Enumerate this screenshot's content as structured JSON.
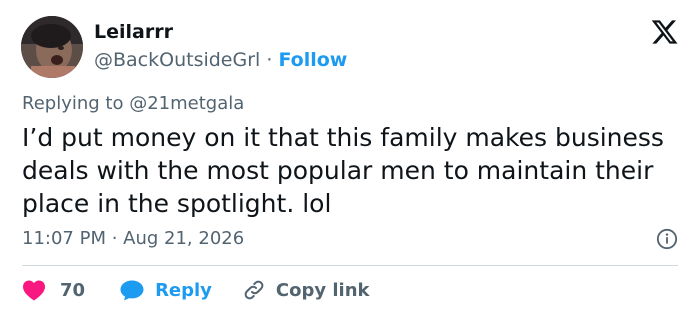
{
  "author": {
    "display_name": "Leilarrr",
    "handle": "@BackOutsideGrl",
    "separator": "·",
    "follow_label": "Follow"
  },
  "reply_context": {
    "prefix": "Replying to",
    "target_handle": "@21metgala"
  },
  "tweet": {
    "text": "I’d put money on it that this family makes business deals with the most popular men to maintain their place in the spotlight. lol",
    "timestamp": "11:07 PM · Aug 21, 2026"
  },
  "actions": {
    "like_count": "70",
    "reply_label": "Reply",
    "copy_link_label": "Copy link"
  },
  "colors": {
    "accent": "#1d9bf0",
    "like": "#f91880",
    "muted_text": "#536471",
    "primary_text": "#0f1419",
    "divider": "#cfd9de"
  },
  "icons": [
    "x-logo-icon",
    "info-icon",
    "heart-icon",
    "reply-bubble-icon",
    "link-icon"
  ]
}
